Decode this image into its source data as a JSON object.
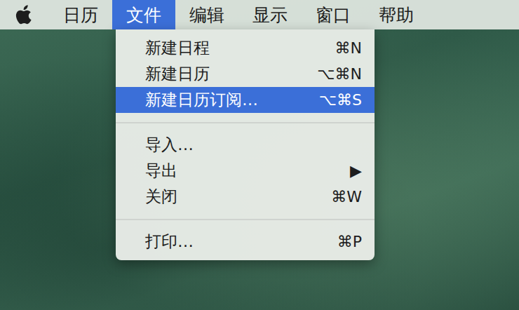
{
  "menubar": {
    "items": [
      {
        "label": "日历",
        "selected": false
      },
      {
        "label": "文件",
        "selected": true
      },
      {
        "label": "编辑",
        "selected": false
      },
      {
        "label": "显示",
        "selected": false
      },
      {
        "label": "窗口",
        "selected": false
      },
      {
        "label": "帮助",
        "selected": false
      }
    ]
  },
  "menu": {
    "items": [
      {
        "kind": "item",
        "label": "新建日程",
        "shortcut": "⌘N",
        "selected": false
      },
      {
        "kind": "item",
        "label": "新建日历",
        "shortcut": "⌥⌘N",
        "selected": false
      },
      {
        "kind": "item",
        "label": "新建日历订阅…",
        "shortcut": "⌥⌘S",
        "selected": true
      },
      {
        "kind": "separator"
      },
      {
        "kind": "item",
        "label": "导入…",
        "shortcut": "",
        "selected": false
      },
      {
        "kind": "item",
        "label": "导出",
        "shortcut": "▶",
        "selected": false
      },
      {
        "kind": "item",
        "label": "关闭",
        "shortcut": "⌘W",
        "selected": false
      },
      {
        "kind": "separator"
      },
      {
        "kind": "item",
        "label": "打印…",
        "shortcut": "⌘P",
        "selected": false
      }
    ]
  }
}
